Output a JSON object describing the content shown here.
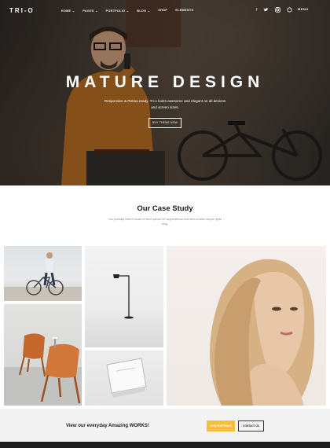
{
  "nav": {
    "logo": "TRI-O",
    "menu": [
      "HOME ⌄",
      "PAGES ⌄",
      "PORTFOLIO ⌄",
      "BLOG ⌄",
      "SHOP",
      "ELEMENTS"
    ],
    "socials": [
      "f",
      "t",
      "ig",
      "☺"
    ],
    "menu_button": "MENU"
  },
  "hero": {
    "title": "MATURE DESIGN",
    "subtitle": "Responsive & Retina ready. Tri-o looks awesome and elegant on all devices and screen sizes.",
    "button": "BUY THEME NOW"
  },
  "case_study": {
    "title": "Our Case Study",
    "subtitle": "You probably haven't heard of them quinoa DIY asymmetrical viral farm-to-table bicycle rights blog."
  },
  "cta": {
    "text": "View our everyday Amazing WORKS!",
    "primary_button": "VIEW PORTFOLIO",
    "secondary_button": "CONTACT US"
  },
  "colors": {
    "accent": "#f6bf3b",
    "dark": "#1c1c1c"
  }
}
